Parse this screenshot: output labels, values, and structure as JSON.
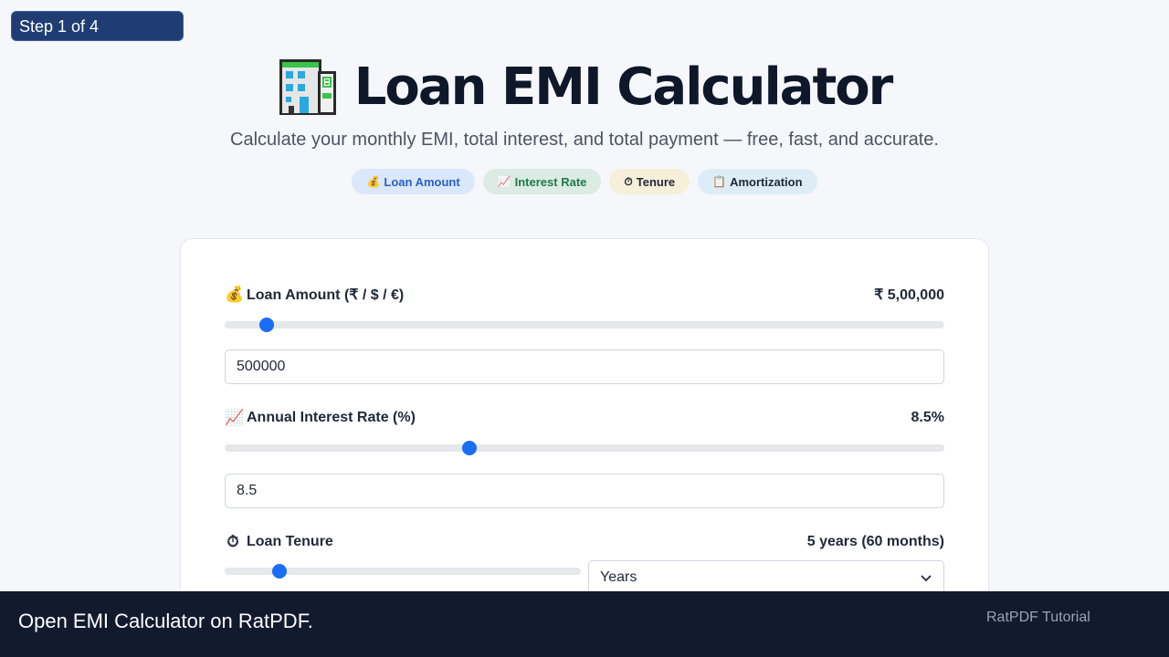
{
  "step": {
    "label": "Step 1 of 4"
  },
  "hero": {
    "icon": "office-building-icon",
    "title": "Loan EMI Calculator",
    "subtitle": "Calculate your monthly EMI, total interest, and total payment — free, fast, and accurate."
  },
  "chips": [
    {
      "icon": "💰",
      "label": "Loan Amount",
      "color": "#2563c9"
    },
    {
      "icon": "📈",
      "label": "Interest Rate",
      "color": "#1f7a4a"
    },
    {
      "icon": "⏱",
      "label": "Tenure",
      "color": "#1f2937"
    },
    {
      "icon": "📋",
      "label": "Amortization",
      "color": "#1f2937"
    }
  ],
  "form": {
    "loan_amount": {
      "icon": "💰",
      "label": "Loan Amount (₹ / $ / €)",
      "display": "₹ 5,00,000",
      "input_value": "500000",
      "slider_level": 0.058
    },
    "interest_rate": {
      "icon": "📈",
      "label": "Annual Interest Rate (%)",
      "display": "8.5%",
      "input_value": "8.5",
      "slider_level": 0.34
    },
    "tenure": {
      "icon": "⏱",
      "label": "Loan Tenure",
      "display": "5 years (60 months)",
      "unit_selected": "Years",
      "slider_level": 0.154
    }
  },
  "footer": {
    "caption": "Open EMI Calculator on RatPDF.",
    "brand": "RatPDF Tutorial"
  },
  "colors": {
    "accent": "#1a6ef5",
    "footer_bg": "#121a2e",
    "step_badge": "#1f3d73"
  }
}
